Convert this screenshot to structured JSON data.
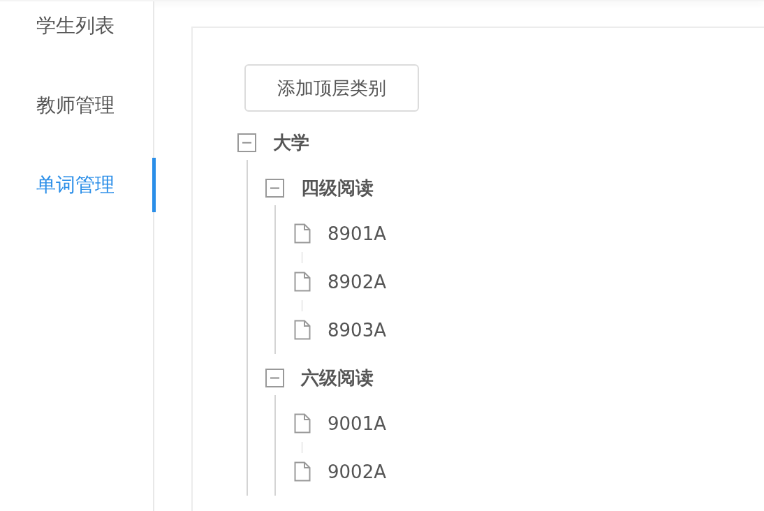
{
  "sidebar": {
    "items": [
      {
        "label": "学生列表",
        "selected": false
      },
      {
        "label": "教师管理",
        "selected": false
      },
      {
        "label": "单词管理",
        "selected": true
      }
    ]
  },
  "content": {
    "add_button": "添加顶层类别",
    "tree": [
      {
        "label": "大学",
        "expanded": true,
        "children": [
          {
            "label": "四级阅读",
            "expanded": true,
            "children": [
              {
                "label": "8901A"
              },
              {
                "label": "8902A"
              },
              {
                "label": "8903A"
              }
            ]
          },
          {
            "label": "六级阅读",
            "expanded": true,
            "children": [
              {
                "label": "9001A"
              },
              {
                "label": "9002A"
              }
            ]
          }
        ]
      }
    ]
  }
}
